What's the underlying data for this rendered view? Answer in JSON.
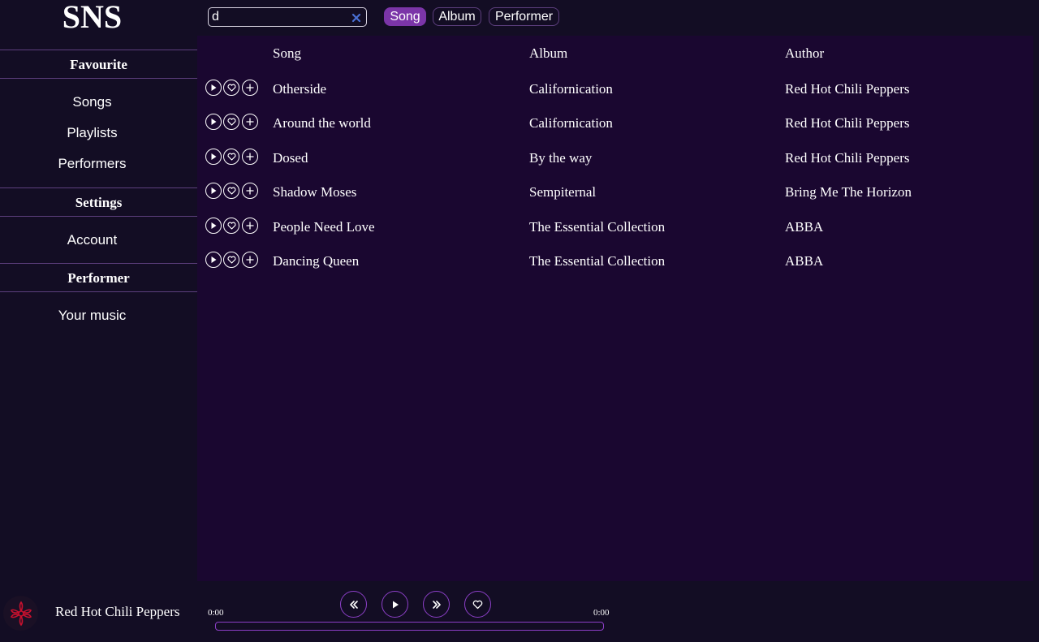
{
  "app": {
    "logo": "SNS"
  },
  "sidebar": {
    "sections": [
      {
        "title": "Favourite",
        "items": [
          "Songs",
          "Playlists",
          "Performers"
        ]
      },
      {
        "title": "Settings",
        "items": [
          "Account"
        ]
      },
      {
        "title": "Performer",
        "items": [
          "Your music"
        ]
      }
    ]
  },
  "search": {
    "value": "d",
    "placeholder": "",
    "filters": [
      {
        "label": "Song",
        "active": true
      },
      {
        "label": "Album",
        "active": false
      },
      {
        "label": "Performer",
        "active": false
      }
    ]
  },
  "table": {
    "columns": [
      "Song",
      "Album",
      "Author"
    ],
    "rows": [
      {
        "song": "Otherside",
        "album": "Californication",
        "author": "Red Hot Chili Peppers"
      },
      {
        "song": "Around the world",
        "album": "Californication",
        "author": "Red Hot Chili Peppers"
      },
      {
        "song": "Dosed",
        "album": "By the way",
        "author": "Red Hot Chili Peppers"
      },
      {
        "song": "Shadow Moses",
        "album": "Sempiternal",
        "author": "Bring Me The Horizon"
      },
      {
        "song": "People Need Love",
        "album": "The Essential Collection",
        "author": "ABBA"
      },
      {
        "song": "Dancing Queen",
        "album": "The Essential Collection",
        "author": "ABBA"
      }
    ],
    "row_actions": [
      "play-icon",
      "heart-icon",
      "plus-icon"
    ]
  },
  "player": {
    "now_playing_artist": "Red Hot Chili Peppers",
    "elapsed": "0:00",
    "duration": "0:00",
    "progress": 0,
    "controls": [
      "rewind-icon",
      "play-icon",
      "fast-forward-icon",
      "heart-icon"
    ]
  },
  "colors": {
    "background": "#130d24",
    "main_panel": "#1a0730",
    "accent": "#8c3fc7",
    "active_filter": "#7b35a8",
    "divider": "#5d3f7e",
    "clear_icon": "#4a6fd4"
  }
}
